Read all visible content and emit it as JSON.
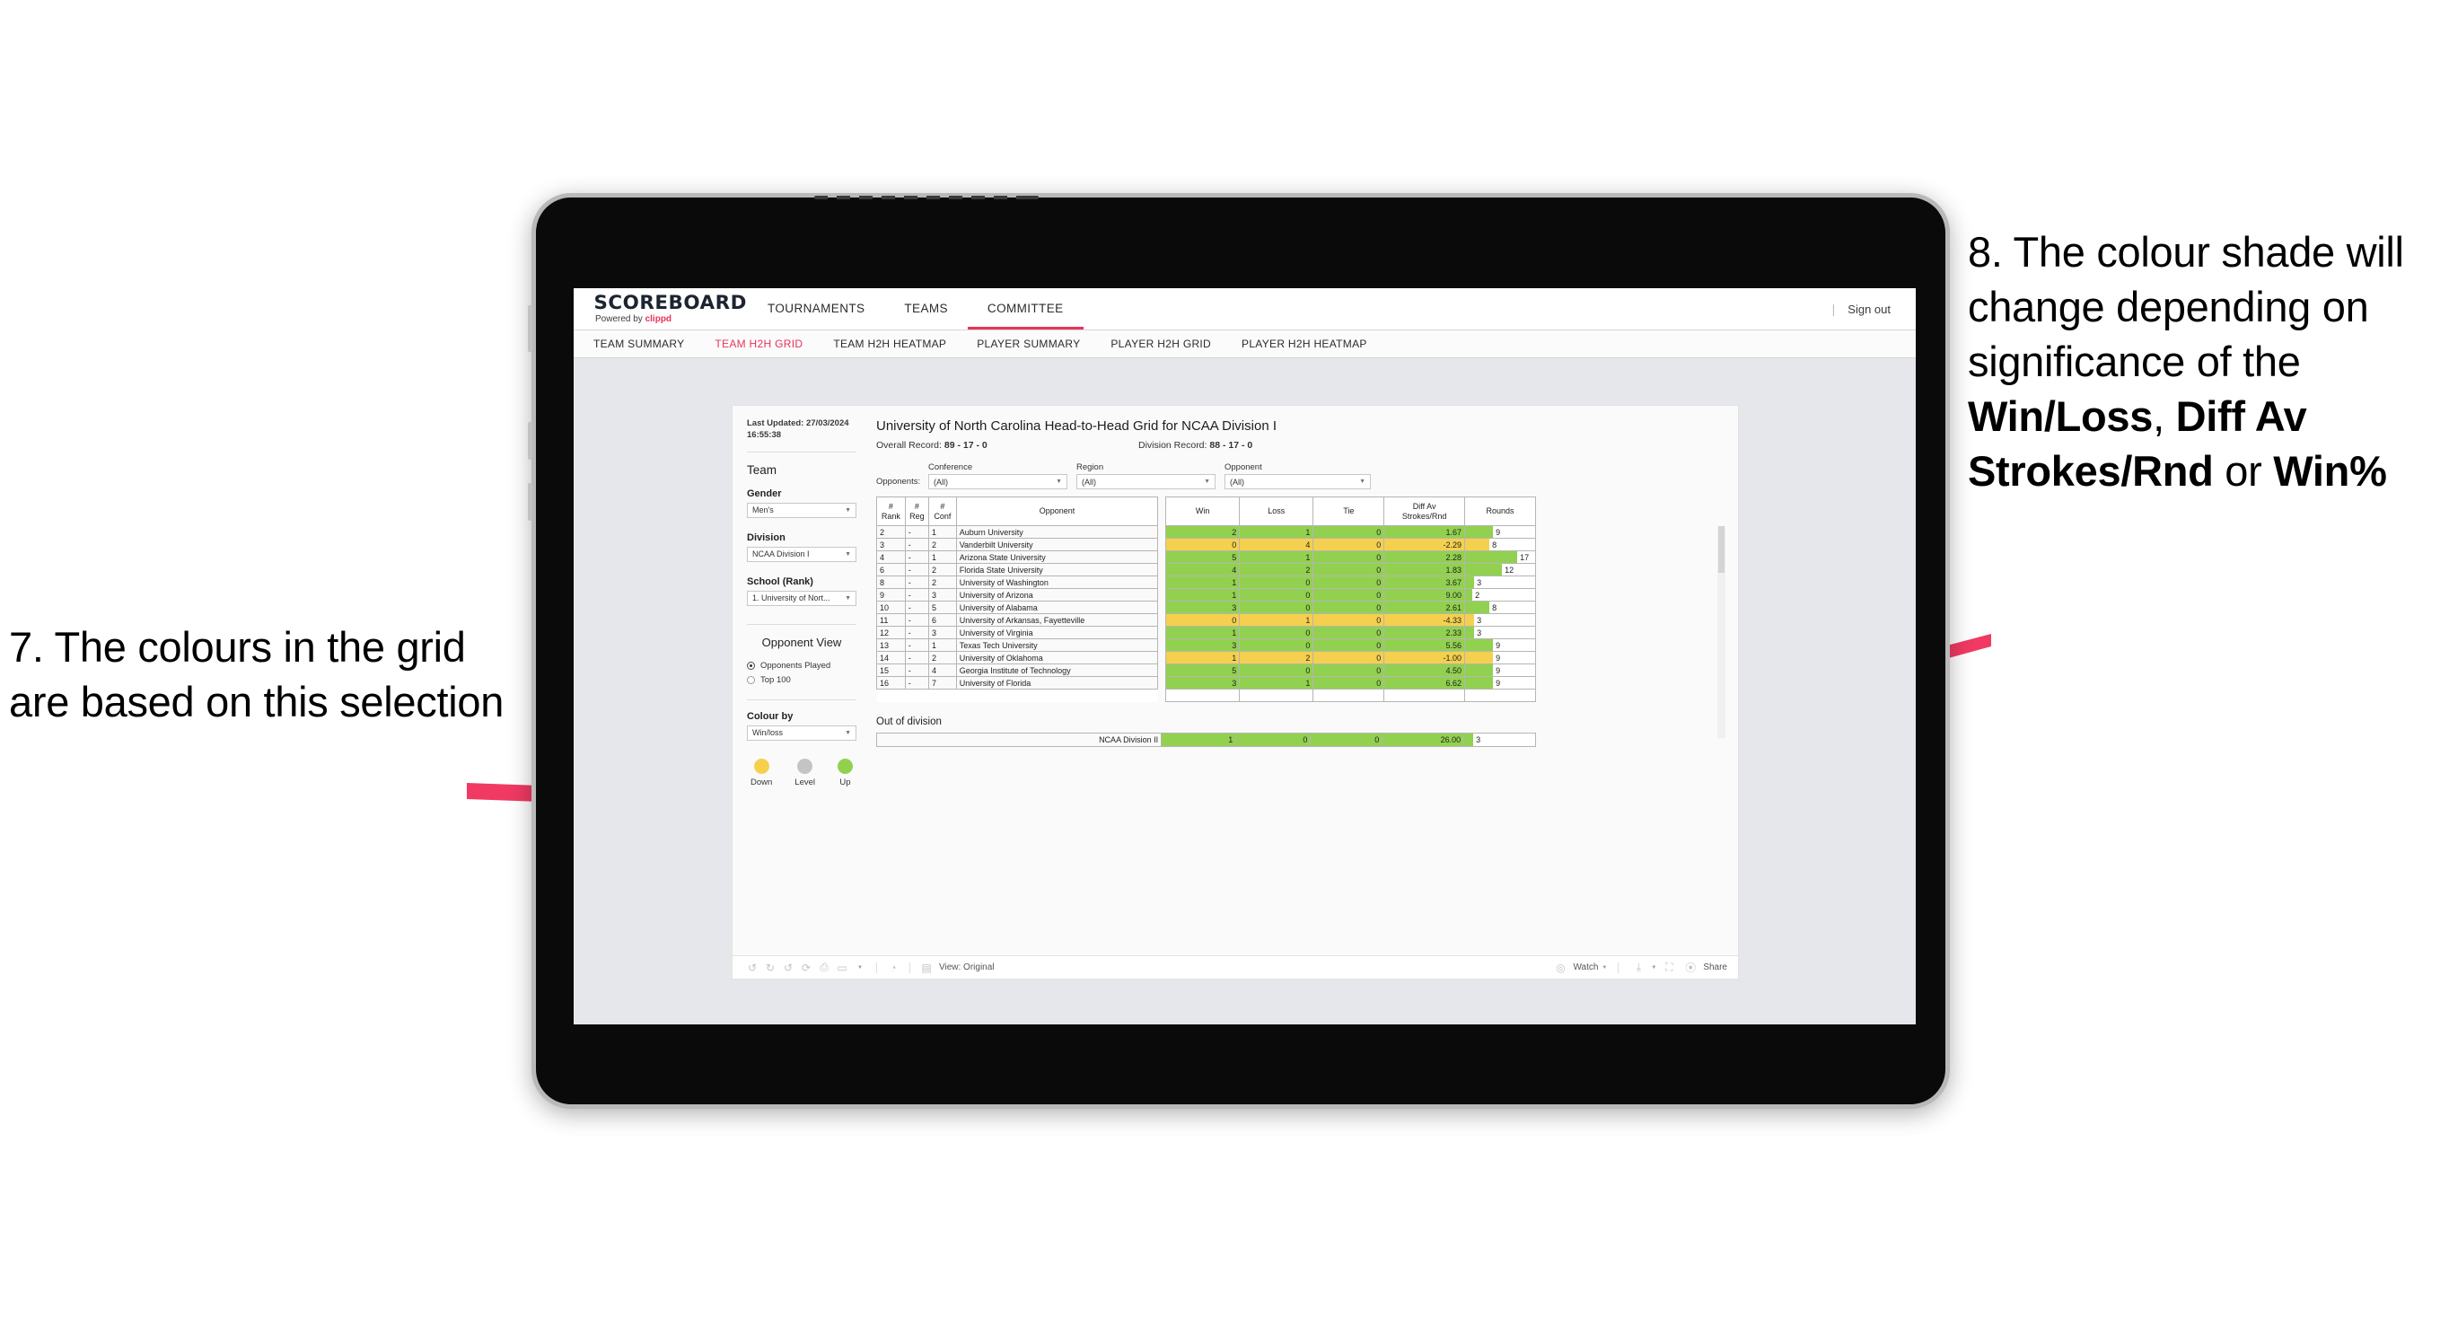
{
  "annotations": {
    "left": {
      "number": "7.",
      "text": "The colours in the grid are based on this selection"
    },
    "right": {
      "line1": "8. The colour shade will change depending on significance of the ",
      "bold1": "Win/Loss",
      "mid1": ", ",
      "bold2": "Diff Av Strokes/Rnd",
      "mid2": " or ",
      "bold3": "Win%"
    }
  },
  "app": {
    "logo": {
      "main": "SCOREBOARD",
      "powered_by": "Powered by",
      "brand": "clippd"
    },
    "topnav": [
      {
        "label": "TOURNAMENTS",
        "active": false
      },
      {
        "label": "TEAMS",
        "active": false
      },
      {
        "label": "COMMITTEE",
        "active": true
      }
    ],
    "signout_label": "Sign out",
    "subnav": [
      {
        "label": "TEAM SUMMARY",
        "active": false
      },
      {
        "label": "TEAM H2H GRID",
        "active": true
      },
      {
        "label": "TEAM H2H HEATMAP",
        "active": false
      },
      {
        "label": "PLAYER SUMMARY",
        "active": false
      },
      {
        "label": "PLAYER H2H GRID",
        "active": false
      },
      {
        "label": "PLAYER H2H HEATMAP",
        "active": false
      }
    ]
  },
  "sidebar": {
    "last_updated_label": "Last Updated:",
    "last_updated_date": "27/03/2024",
    "last_updated_time": "16:55:38",
    "team_heading": "Team",
    "gender": {
      "label": "Gender",
      "value": "Men's"
    },
    "division": {
      "label": "Division",
      "value": "NCAA Division I"
    },
    "school": {
      "label": "School (Rank)",
      "value": "1. University of Nort..."
    },
    "opponent_view": {
      "heading": "Opponent View",
      "options": [
        {
          "label": "Opponents Played",
          "selected": true
        },
        {
          "label": "Top 100",
          "selected": false
        }
      ]
    },
    "colour_by": {
      "label": "Colour by",
      "value": "Win/loss"
    },
    "legend": [
      {
        "label": "Down",
        "color": "#f5d04e"
      },
      {
        "label": "Level",
        "color": "#c4c4c4"
      },
      {
        "label": "Up",
        "color": "#92d14f"
      }
    ]
  },
  "main": {
    "title": "University of North Carolina Head-to-Head Grid for NCAA Division I",
    "overall_record_label": "Overall Record:",
    "overall_record": "89 - 17 - 0",
    "division_record_label": "Division Record:",
    "division_record": "88 - 17 - 0",
    "opponents_label": "Opponents:",
    "filters": [
      {
        "label": "Conference",
        "value": "(All)"
      },
      {
        "label": "Region",
        "value": "(All)"
      },
      {
        "label": "Opponent",
        "value": "(All)"
      }
    ],
    "out_of_division_heading": "Out of division"
  },
  "chart_data": {
    "type": "table",
    "title": "University of North Carolina Head-to-Head Grid for NCAA Division I",
    "columns": [
      "# Rank",
      "# Reg",
      "# Conf",
      "Opponent",
      "Win",
      "Loss",
      "Tie",
      "Diff Av Strokes/Rnd",
      "Rounds"
    ],
    "column_headers_two_line": {
      "rank": [
        "#",
        "Rank"
      ],
      "reg": [
        "#",
        "Reg"
      ],
      "conf": [
        "#",
        "Conf"
      ],
      "opponent": [
        "Opponent"
      ],
      "win": [
        "Win"
      ],
      "loss": [
        "Loss"
      ],
      "tie": [
        "Tie"
      ],
      "diff": [
        "Diff Av",
        "Strokes/Rnd"
      ],
      "rounds": [
        "Rounds"
      ]
    },
    "rounds_max": 17,
    "rows": [
      {
        "rank": "2",
        "reg": "-",
        "conf": "1",
        "opponent": "Auburn University",
        "win": 2,
        "loss": 1,
        "tie": 0,
        "diff": "1.67",
        "rounds": 9,
        "color": "green"
      },
      {
        "rank": "3",
        "reg": "-",
        "conf": "2",
        "opponent": "Vanderbilt University",
        "win": 0,
        "loss": 4,
        "tie": 0,
        "diff": "-2.29",
        "rounds": 8,
        "color": "yellow"
      },
      {
        "rank": "4",
        "reg": "-",
        "conf": "1",
        "opponent": "Arizona State University",
        "win": 5,
        "loss": 1,
        "tie": 0,
        "diff": "2.28",
        "rounds": 17,
        "color": "green"
      },
      {
        "rank": "6",
        "reg": "-",
        "conf": "2",
        "opponent": "Florida State University",
        "win": 4,
        "loss": 2,
        "tie": 0,
        "diff": "1.83",
        "rounds": 12,
        "color": "green"
      },
      {
        "rank": "8",
        "reg": "-",
        "conf": "2",
        "opponent": "University of Washington",
        "win": 1,
        "loss": 0,
        "tie": 0,
        "diff": "3.67",
        "rounds": 3,
        "color": "green"
      },
      {
        "rank": "9",
        "reg": "-",
        "conf": "3",
        "opponent": "University of Arizona",
        "win": 1,
        "loss": 0,
        "tie": 0,
        "diff": "9.00",
        "rounds": 2,
        "color": "green"
      },
      {
        "rank": "10",
        "reg": "-",
        "conf": "5",
        "opponent": "University of Alabama",
        "win": 3,
        "loss": 0,
        "tie": 0,
        "diff": "2.61",
        "rounds": 8,
        "color": "green"
      },
      {
        "rank": "11",
        "reg": "-",
        "conf": "6",
        "opponent": "University of Arkansas, Fayetteville",
        "win": 0,
        "loss": 1,
        "tie": 0,
        "diff": "-4.33",
        "rounds": 3,
        "color": "yellow"
      },
      {
        "rank": "12",
        "reg": "-",
        "conf": "3",
        "opponent": "University of Virginia",
        "win": 1,
        "loss": 0,
        "tie": 0,
        "diff": "2.33",
        "rounds": 3,
        "color": "green"
      },
      {
        "rank": "13",
        "reg": "-",
        "conf": "1",
        "opponent": "Texas Tech University",
        "win": 3,
        "loss": 0,
        "tie": 0,
        "diff": "5.56",
        "rounds": 9,
        "color": "green"
      },
      {
        "rank": "14",
        "reg": "-",
        "conf": "2",
        "opponent": "University of Oklahoma",
        "win": 1,
        "loss": 2,
        "tie": 0,
        "diff": "-1.00",
        "rounds": 9,
        "color": "yellow"
      },
      {
        "rank": "15",
        "reg": "-",
        "conf": "4",
        "opponent": "Georgia Institute of Technology",
        "win": 5,
        "loss": 0,
        "tie": 0,
        "diff": "4.50",
        "rounds": 9,
        "color": "green"
      },
      {
        "rank": "16",
        "reg": "-",
        "conf": "7",
        "opponent": "University of Florida",
        "win": 3,
        "loss": 1,
        "tie": 0,
        "diff": "6.62",
        "rounds": 9,
        "color": "green"
      }
    ],
    "out_of_division": [
      {
        "opponent": "NCAA Division II",
        "win": 1,
        "loss": 0,
        "tie": 0,
        "diff": "26.00",
        "rounds": 3,
        "color": "green"
      }
    ]
  },
  "toolbar": {
    "view_label": "View: Original",
    "watch_label": "Watch",
    "share_label": "Share",
    "icons": [
      "undo-icon",
      "redo-icon",
      "revert-icon",
      "refresh-icon",
      "pause-icon",
      "pill-icon",
      "chevron-down-icon",
      "alert-icon",
      "view-icon",
      "watch-icon",
      "download-icon",
      "fullscreen-icon",
      "share-icon"
    ]
  }
}
